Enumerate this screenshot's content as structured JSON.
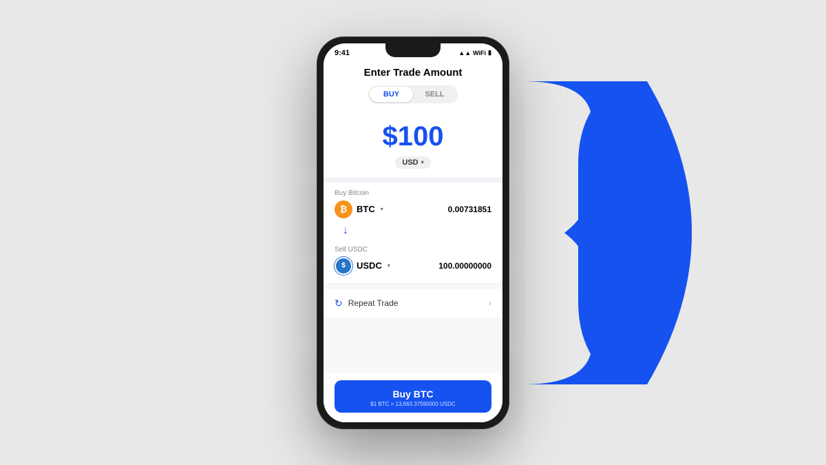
{
  "background": {
    "arrowColor": "#1652f0"
  },
  "statusBar": {
    "time": "9:41",
    "icons": "▲▲ 📶 🔋"
  },
  "header": {
    "title": "Enter Trade Amount"
  },
  "toggle": {
    "buyLabel": "BUY",
    "sellLabel": "SELL",
    "active": "buy"
  },
  "amount": {
    "value": "$100",
    "currency": "USD",
    "chevron": "▾"
  },
  "buySection": {
    "label": "Buy Bitcoin",
    "coinName": "BTC",
    "coinAmount": "0.00731851",
    "iconText": "₿"
  },
  "sellSection": {
    "label": "Sell USDC",
    "coinName": "USDC",
    "coinAmount": "100.00000000",
    "iconText": "$"
  },
  "repeatTrade": {
    "label": "Repeat Trade",
    "chevron": "›"
  },
  "buyButton": {
    "title": "Buy BTC",
    "subtitle": "$1 BTC = 13,663.37590000 USDC"
  }
}
